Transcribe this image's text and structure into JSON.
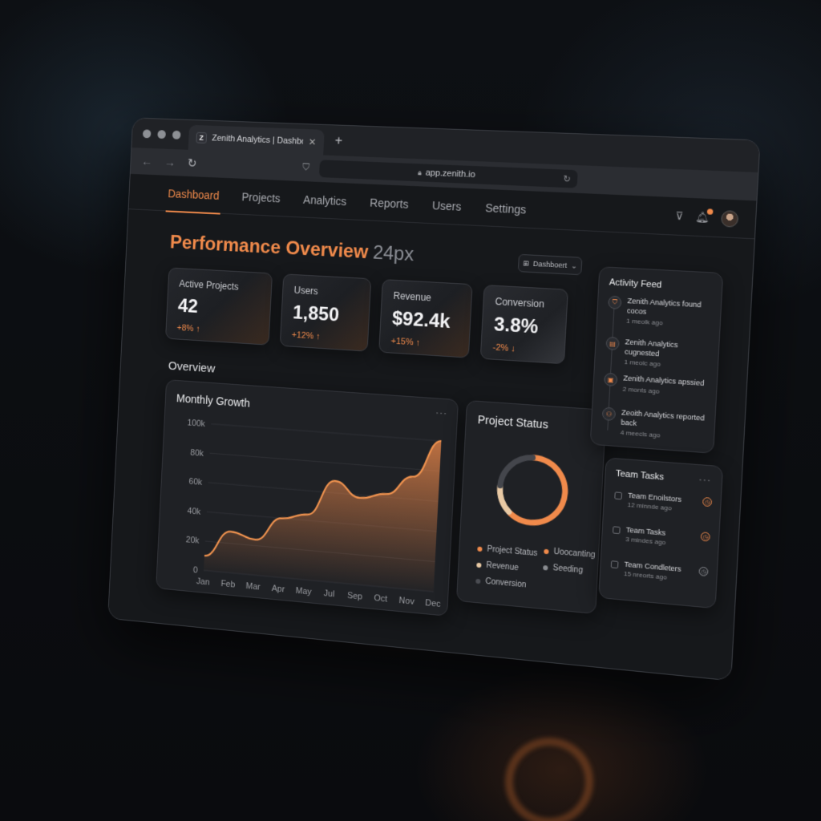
{
  "browser": {
    "tab_title": "Zenith Analytics | Dashboard",
    "favicon_letter": "Z",
    "url": "app.zenith.io"
  },
  "nav": {
    "items": [
      "Dashboard",
      "Projects",
      "Analytics",
      "Reports",
      "Users",
      "Settings"
    ],
    "active": "Dashboard"
  },
  "page": {
    "title": "Performance Overview",
    "title_suffix": "24px",
    "view_select": "Dashboert"
  },
  "kpis": [
    {
      "label": "Active Projects",
      "value": "42",
      "delta": "+8% ↑"
    },
    {
      "label": "Users",
      "value": "1,850",
      "delta": "+12% ↑"
    },
    {
      "label": "Revenue",
      "value": "$92.4k",
      "delta": "+15% ↑"
    },
    {
      "label": "Conversion",
      "value": "3.8%",
      "delta": "-2% ↓"
    }
  ],
  "overview_label": "Overview",
  "growth_card": {
    "title": "Monthly Growth",
    "menu": "···"
  },
  "status_card": {
    "title": "Project Status"
  },
  "activity": {
    "title": "Activity Feed",
    "items": [
      {
        "text": "Zenith Analytics found cocos",
        "time": "1 meolk ago",
        "icon": "shield-icon"
      },
      {
        "text": "Zenith Analytics cugnested",
        "time": "1 meolc ago",
        "icon": "document-icon"
      },
      {
        "text": "Zenith Analytics apssied",
        "time": "2 monts ago",
        "icon": "folder-icon"
      },
      {
        "text": "Zeoith Analytics reported back",
        "time": "4 meecls ago",
        "icon": "users-icon"
      }
    ]
  },
  "tasks": {
    "title": "Team Tasks",
    "menu": "···",
    "items": [
      {
        "text": "Team Enoilstors",
        "time": "12 minnde ago",
        "clock": "accent"
      },
      {
        "text": "Team Tasks",
        "time": "3 mindes ago",
        "clock": "accent"
      },
      {
        "text": "Team Condleters",
        "time": "15 nreorts ago",
        "clock": "grey"
      }
    ]
  },
  "colors": {
    "accent": "#f08a4b",
    "donut_light": "#e8c9a4",
    "card_bg": "#1f2125"
  },
  "chart_data": [
    {
      "type": "area",
      "title": "Monthly Growth",
      "categories": [
        "Jan",
        "Feb",
        "Mar",
        "Apr",
        "May",
        "Jul",
        "Sep",
        "Oct",
        "Nov",
        "Dec"
      ],
      "values": [
        10,
        28,
        24,
        40,
        44,
        68,
        58,
        62,
        75,
        100
      ],
      "y_ticks": [
        "100k",
        "80k",
        "60k",
        "40k",
        "20k",
        "0"
      ],
      "ylim": [
        0,
        100
      ],
      "grid": true
    },
    {
      "type": "pie",
      "title": "Project Status",
      "legend": [
        {
          "label": "Project Status",
          "color": "#f08a4b"
        },
        {
          "label": "Uoocanting",
          "color": "#f08a4b"
        },
        {
          "label": "Revenue",
          "color": "#e8c9a4"
        },
        {
          "label": "Seeding",
          "color": "#8a8c91"
        },
        {
          "label": "Conversion",
          "color": "#4a4c52"
        }
      ],
      "values": [
        62,
        14,
        24
      ],
      "segment_colors": [
        "#f08a4b",
        "#e8c9a4",
        "#44464c"
      ]
    }
  ]
}
